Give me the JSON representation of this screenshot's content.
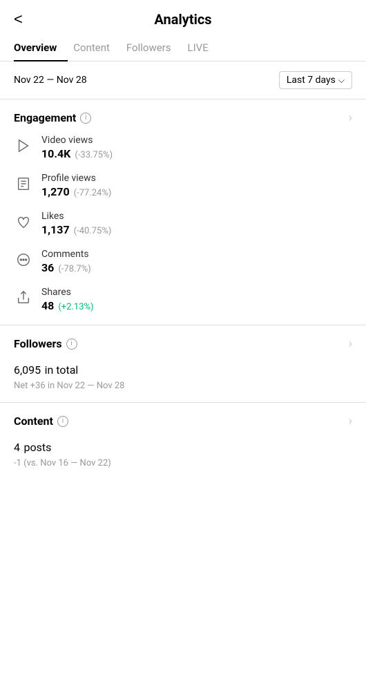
{
  "header": {
    "back_label": "<",
    "title": "Analytics"
  },
  "tabs": [
    {
      "id": "overview",
      "label": "Overview",
      "active": true
    },
    {
      "id": "content",
      "label": "Content",
      "active": false
    },
    {
      "id": "followers",
      "label": "Followers",
      "active": false
    },
    {
      "id": "live",
      "label": "LIVE",
      "active": false
    }
  ],
  "date_range": {
    "text": "Nov 22 — Nov 28",
    "dropdown_label": "Last 7 days"
  },
  "engagement": {
    "section_title": "Engagement",
    "info_symbol": "i",
    "metrics": [
      {
        "id": "video-views",
        "label": "Video views",
        "value": "10.4K",
        "change": "(-33.75%)",
        "positive": false
      },
      {
        "id": "profile-views",
        "label": "Profile views",
        "value": "1,270",
        "change": "(-77.24%)",
        "positive": false
      },
      {
        "id": "likes",
        "label": "Likes",
        "value": "1,137",
        "change": "(-40.75%)",
        "positive": false
      },
      {
        "id": "comments",
        "label": "Comments",
        "value": "36",
        "change": "(-78.7%)",
        "positive": false
      },
      {
        "id": "shares",
        "label": "Shares",
        "value": "48",
        "change": "(+2.13%)",
        "positive": true
      }
    ]
  },
  "followers_section": {
    "section_title": "Followers",
    "info_symbol": "i",
    "total_count": "6,095",
    "total_label": "in total",
    "net_text": "Net +36 in Nov 22 — Nov 28"
  },
  "content_section": {
    "section_title": "Content",
    "info_symbol": "i",
    "posts_count": "4",
    "posts_label": "posts",
    "compare_text": "-1 (vs. Nov 16 — Nov 22)"
  }
}
